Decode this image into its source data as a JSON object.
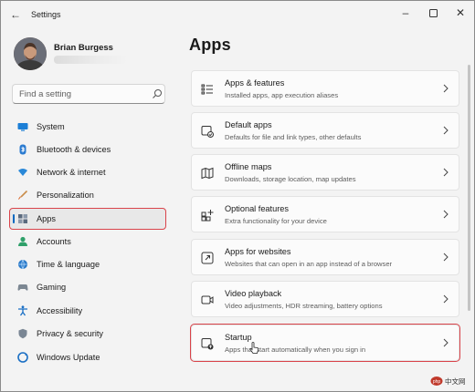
{
  "window": {
    "title": "Settings"
  },
  "account": {
    "name": "Brian Burgess"
  },
  "search": {
    "placeholder": "Find a setting"
  },
  "sidebar": {
    "items": [
      {
        "label": "System",
        "icon": "system-icon"
      },
      {
        "label": "Bluetooth & devices",
        "icon": "bluetooth-icon"
      },
      {
        "label": "Network & internet",
        "icon": "network-icon"
      },
      {
        "label": "Personalization",
        "icon": "brush-icon"
      },
      {
        "label": "Apps",
        "icon": "apps-icon",
        "selected": true
      },
      {
        "label": "Accounts",
        "icon": "person-icon"
      },
      {
        "label": "Time & language",
        "icon": "globe-clock-icon"
      },
      {
        "label": "Gaming",
        "icon": "gamepad-icon"
      },
      {
        "label": "Accessibility",
        "icon": "accessibility-icon"
      },
      {
        "label": "Privacy & security",
        "icon": "shield-icon"
      },
      {
        "label": "Windows Update",
        "icon": "update-icon"
      }
    ]
  },
  "main": {
    "title": "Apps",
    "cards": [
      {
        "title": "Apps & features",
        "description": "Installed apps, app execution aliases",
        "icon": "list-icon"
      },
      {
        "title": "Default apps",
        "description": "Defaults for file and link types, other defaults",
        "icon": "default-apps-icon"
      },
      {
        "title": "Offline maps",
        "description": "Downloads, storage location, map updates",
        "icon": "map-icon"
      },
      {
        "title": "Optional features",
        "description": "Extra functionality for your device",
        "icon": "optional-features-icon"
      },
      {
        "title": "Apps for websites",
        "description": "Websites that can open in an app instead of a browser",
        "icon": "open-external-icon"
      },
      {
        "title": "Video playback",
        "description": "Video adjustments, HDR streaming, battery options",
        "icon": "video-icon"
      },
      {
        "title": "Startup",
        "description": "Apps that start automatically when you sign in",
        "icon": "startup-icon",
        "highlighted": true
      }
    ]
  },
  "watermark": {
    "text": "中文网"
  },
  "colors": {
    "accent": "#0067c0",
    "highlight": "#d9434a",
    "background": "#f3f3f3",
    "card": "#fbfbfb"
  }
}
